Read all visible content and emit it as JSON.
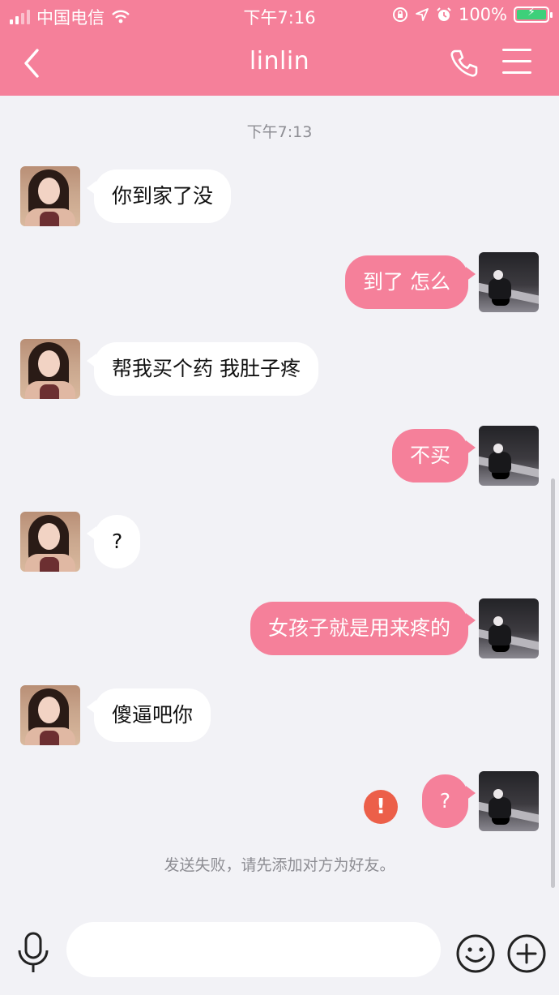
{
  "status_bar": {
    "carrier": "中国电信",
    "time": "下午7:16",
    "battery": "100%",
    "icons": [
      "signal-icon",
      "wifi-icon",
      "lock-rotation-icon",
      "location-icon",
      "alarm-icon",
      "battery-icon"
    ]
  },
  "header": {
    "title": "linlin",
    "back_icon": "chevron-left-icon",
    "call_icon": "phone-icon",
    "menu_icon": "hamburger-menu-icon"
  },
  "chat": {
    "timestamp": "下午7:13",
    "messages": [
      {
        "side": "left",
        "text": "你到家了没"
      },
      {
        "side": "right",
        "text": "到了 怎么"
      },
      {
        "side": "left",
        "text": "帮我买个药 我肚子疼"
      },
      {
        "side": "right",
        "text": "不买"
      },
      {
        "side": "left",
        "text": "?"
      },
      {
        "side": "right",
        "text": "女孩子就是用来疼的"
      },
      {
        "side": "left",
        "text": "傻逼吧你"
      },
      {
        "side": "right",
        "text": "?",
        "status": "failed"
      }
    ],
    "error_mark": "!",
    "fail_notice": "发送失败，请先添加对方为好友。"
  },
  "input_bar": {
    "placeholder": "",
    "icons": [
      "microphone-icon",
      "emoji-icon",
      "plus-icon"
    ]
  },
  "colors": {
    "accent": "#f5809a",
    "background": "#f2f2f6",
    "error": "#ec5f49"
  }
}
